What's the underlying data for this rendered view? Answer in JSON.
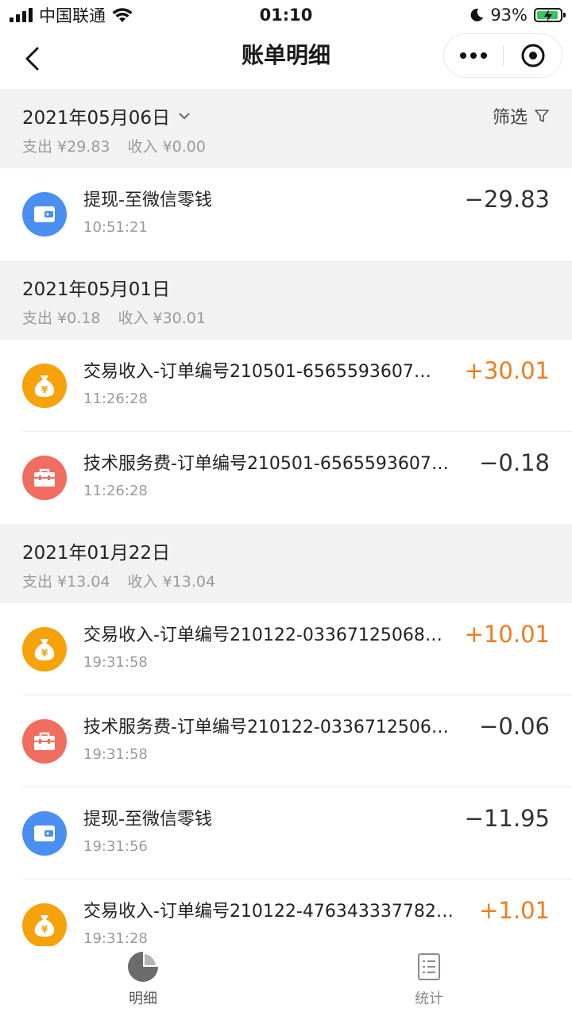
{
  "status_bar": {
    "carrier": "中国联通",
    "time": "01:10",
    "battery": "93%",
    "battery_level": 0.93
  },
  "nav": {
    "title": "账单明细"
  },
  "groups": [
    {
      "date": "2021年05月06日",
      "has_dropdown": true,
      "filter_label": "筛选",
      "expense": "支出 ¥29.83",
      "income": "收入 ¥0.00",
      "items": [
        {
          "icon": "wallet-icon",
          "color": "#4a8ff2",
          "title": "提现-至微信零钱",
          "time": "10:51:21",
          "amount": "−29.83",
          "type": "expense"
        }
      ]
    },
    {
      "date": "2021年05月01日",
      "expense": "支出 ¥0.18",
      "income": "收入 ¥30.01",
      "items": [
        {
          "icon": "money-bag-icon",
          "color": "#f5a20b",
          "title": "交易收入-订单编号210501-6565593607…",
          "time": "11:26:28",
          "amount": "+30.01",
          "type": "income"
        },
        {
          "icon": "toolbox-icon",
          "color": "#f16d5f",
          "title": "技术服务费-订单编号210501-6565593607…",
          "time": "11:26:28",
          "amount": "−0.18",
          "type": "expense"
        }
      ]
    },
    {
      "date": "2021年01月22日",
      "expense": "支出 ¥13.04",
      "income": "收入 ¥13.04",
      "items": [
        {
          "icon": "money-bag-icon",
          "color": "#f5a20b",
          "title": "交易收入-订单编号210122-03367125068…",
          "time": "19:31:58",
          "amount": "+10.01",
          "type": "income"
        },
        {
          "icon": "toolbox-icon",
          "color": "#f16d5f",
          "title": "技术服务费-订单编号210122-0336712506…",
          "time": "19:31:58",
          "amount": "−0.06",
          "type": "expense"
        },
        {
          "icon": "wallet-icon",
          "color": "#4a8ff2",
          "title": "提现-至微信零钱",
          "time": "19:31:56",
          "amount": "−11.95",
          "type": "expense"
        },
        {
          "icon": "money-bag-icon",
          "color": "#f5a20b",
          "title": "交易收入-订单编号210122-476343337782…",
          "time": "19:31:28",
          "amount": "+1.01",
          "type": "income"
        }
      ]
    }
  ],
  "tabs": [
    {
      "label": "明细",
      "icon": "pie-chart-icon",
      "active": true
    },
    {
      "label": "统计",
      "icon": "list-icon",
      "active": false
    }
  ],
  "colors": {
    "income": "#f07c1c",
    "expense": "#333333",
    "header_bg": "#f2f2f2"
  }
}
